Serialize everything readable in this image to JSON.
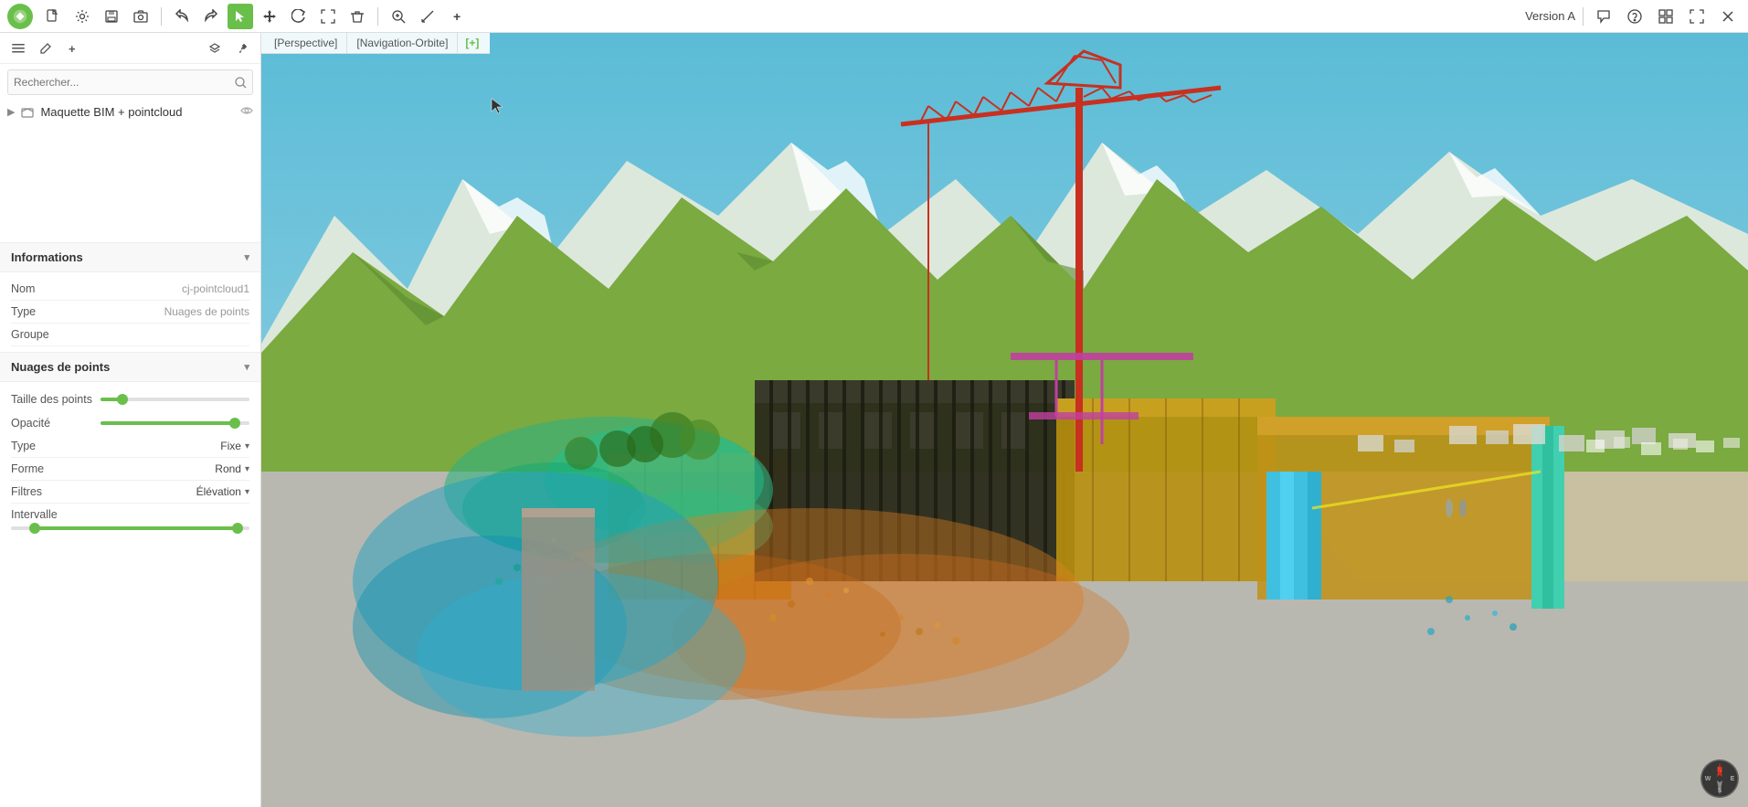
{
  "app": {
    "logo_alt": "App Logo",
    "version": "Version A"
  },
  "toolbar": {
    "buttons": [
      {
        "id": "file-new",
        "icon": "📄",
        "label": "New"
      },
      {
        "id": "file-settings",
        "icon": "⚙",
        "label": "Settings"
      },
      {
        "id": "file-save",
        "icon": "💾",
        "label": "Save"
      },
      {
        "id": "file-camera",
        "icon": "📷",
        "label": "Camera"
      }
    ],
    "separator1": true,
    "nav_buttons": [
      {
        "id": "undo",
        "icon": "↩",
        "label": "Undo"
      },
      {
        "id": "redo",
        "icon": "↪",
        "label": "Redo"
      },
      {
        "id": "select",
        "icon": "↖",
        "label": "Select",
        "active": true
      },
      {
        "id": "move",
        "icon": "✛",
        "label": "Move"
      },
      {
        "id": "reset",
        "icon": "↺",
        "label": "Reset"
      },
      {
        "id": "fit",
        "icon": "⛶",
        "label": "Fit"
      },
      {
        "id": "delete",
        "icon": "🗑",
        "label": "Delete"
      }
    ],
    "separator2": true,
    "view_buttons": [
      {
        "id": "zoom",
        "icon": "🔍",
        "label": "Zoom"
      },
      {
        "id": "measure",
        "icon": "📏",
        "label": "Measure"
      },
      {
        "id": "add",
        "icon": "+",
        "label": "Add"
      }
    ],
    "right_buttons": [
      {
        "id": "chat",
        "icon": "💬",
        "label": "Chat"
      },
      {
        "id": "help",
        "icon": "❓",
        "label": "Help"
      },
      {
        "id": "grid",
        "icon": "⊞",
        "label": "Grid"
      },
      {
        "id": "fullscreen",
        "icon": "⛶",
        "label": "Fullscreen"
      },
      {
        "id": "close",
        "icon": "✕",
        "label": "Close"
      }
    ]
  },
  "left_panel": {
    "toolbar": [
      {
        "id": "menu",
        "icon": "☰",
        "label": "Menu"
      },
      {
        "id": "edit",
        "icon": "✏",
        "label": "Edit"
      },
      {
        "id": "add",
        "icon": "+",
        "label": "Add"
      },
      {
        "id": "layers",
        "icon": "⊞",
        "label": "Layers"
      },
      {
        "id": "pin",
        "icon": "📌",
        "label": "Pin"
      }
    ],
    "search_placeholder": "Rechercher...",
    "tree": {
      "item_label": "Maquette BIM + pointcloud",
      "item_expanded": true,
      "item_eye": true
    },
    "sections": {
      "informations": {
        "title": "Informations",
        "collapsed": false,
        "properties": [
          {
            "label": "Nom",
            "value": "cj-pointcloud1"
          },
          {
            "label": "Type",
            "value": "Nuages de points"
          },
          {
            "label": "Groupe",
            "value": ""
          }
        ]
      },
      "nuages_de_points": {
        "title": "Nuages de points",
        "collapsed": false,
        "sliders": [
          {
            "label": "Taille des points",
            "value": 15,
            "max": 100
          },
          {
            "label": "Opacité",
            "value": 90,
            "max": 100
          }
        ],
        "dropdowns": [
          {
            "label": "Type",
            "value": "Fixe"
          },
          {
            "label": "Forme",
            "value": "Rond"
          },
          {
            "label": "Filtres",
            "value": "Élévation"
          }
        ],
        "interval": {
          "label": "Intervalle",
          "min_pct": 10,
          "max_pct": 95
        }
      }
    }
  },
  "viewport": {
    "tabs": [
      {
        "label": "[Perspective]"
      },
      {
        "label": "[Navigation-Orbite]"
      },
      {
        "label": "[+]",
        "is_add": true
      }
    ]
  },
  "compass": {
    "label": "N"
  }
}
